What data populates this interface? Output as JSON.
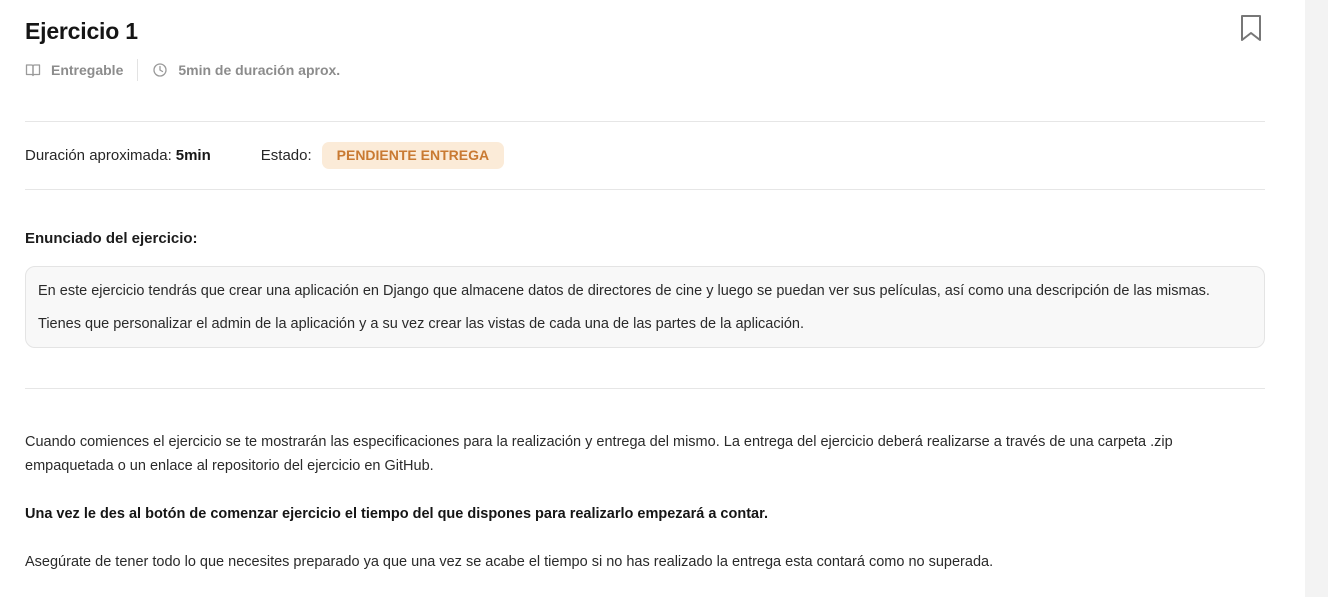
{
  "header": {
    "title": "Ejercicio 1",
    "bookmark_icon": "bookmark-icon",
    "meta": [
      {
        "icon": "book-icon",
        "label": "Entregable"
      },
      {
        "icon": "clock-icon",
        "label": "5min de duración aprox."
      }
    ]
  },
  "info": {
    "duration_label": "Duración aproximada:",
    "duration_value": "5min",
    "status_label": "Estado:",
    "status_value": "PENDIENTE ENTREGA",
    "status_color": "#c97a32",
    "status_bg": "#fbebd8"
  },
  "statement": {
    "title": "Enunciado del ejercicio:",
    "lines": [
      "En este ejercicio tendrás que crear una aplicación en Django que almacene datos de directores de cine y luego se puedan ver sus películas, así como una descripción de las mismas.",
      "Tienes que personalizar el admin de la aplicación y a su vez crear las vistas de cada una de las partes de la aplicación."
    ]
  },
  "instructions": {
    "p1": "Cuando comiences el ejercicio se te mostrarán las especificaciones para la realización y entrega del mismo. La entrega del ejercicio deberá realizarse a través de una carpeta .zip empaquetada o un enlace al repositorio del ejercicio en GitHub.",
    "p2": "Una vez le des al botón de comenzar ejercicio el tiempo del que dispones para realizarlo empezará a contar.",
    "p3": "Asegúrate de tener todo lo que necesites preparado ya que una vez se acabe el tiempo si no has realizado la entrega esta contará como no superada."
  }
}
